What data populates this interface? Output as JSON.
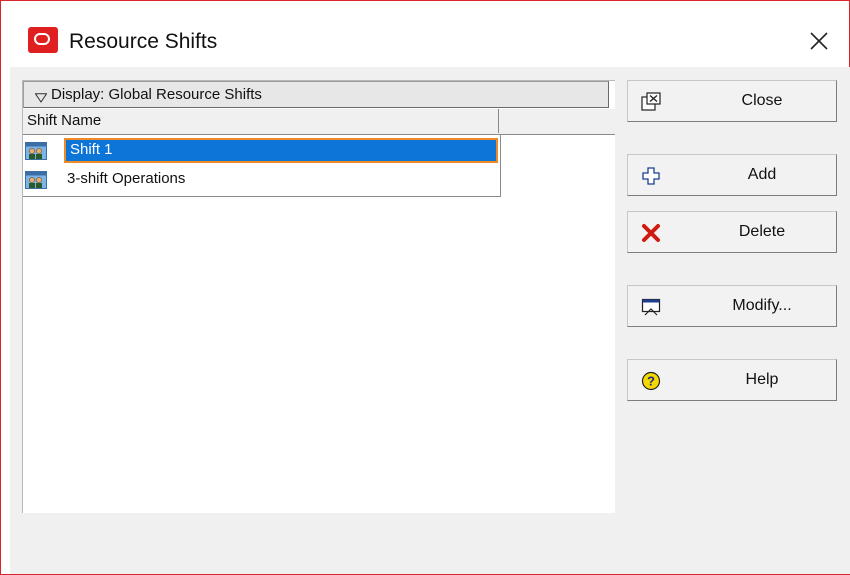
{
  "window": {
    "title": "Resource Shifts"
  },
  "display": {
    "label": "Display: Global Resource Shifts"
  },
  "table": {
    "columns": [
      "Shift Name"
    ],
    "rows": [
      {
        "name": "Shift 1",
        "selected": true
      },
      {
        "name": "3-shift Operations",
        "selected": false
      }
    ]
  },
  "buttons": {
    "close": "Close",
    "add": "Add",
    "delete": "Delete",
    "modify": "Modify...",
    "help": "Help"
  },
  "icons": {
    "app": "oracle-logo-icon",
    "close_window": "close-icon",
    "display_toggle": "triangle-down-icon",
    "shift_row": "shift-people-icon",
    "close_button": "close-window-icon",
    "add_button": "plus-icon",
    "delete_button": "red-x-icon",
    "modify_button": "modify-window-icon",
    "help_button": "help-question-icon"
  },
  "colors": {
    "window_border": "#d9262a",
    "selection_fill": "#0d74d8",
    "selection_outline": "#f08a24",
    "brand": "#e02020"
  }
}
